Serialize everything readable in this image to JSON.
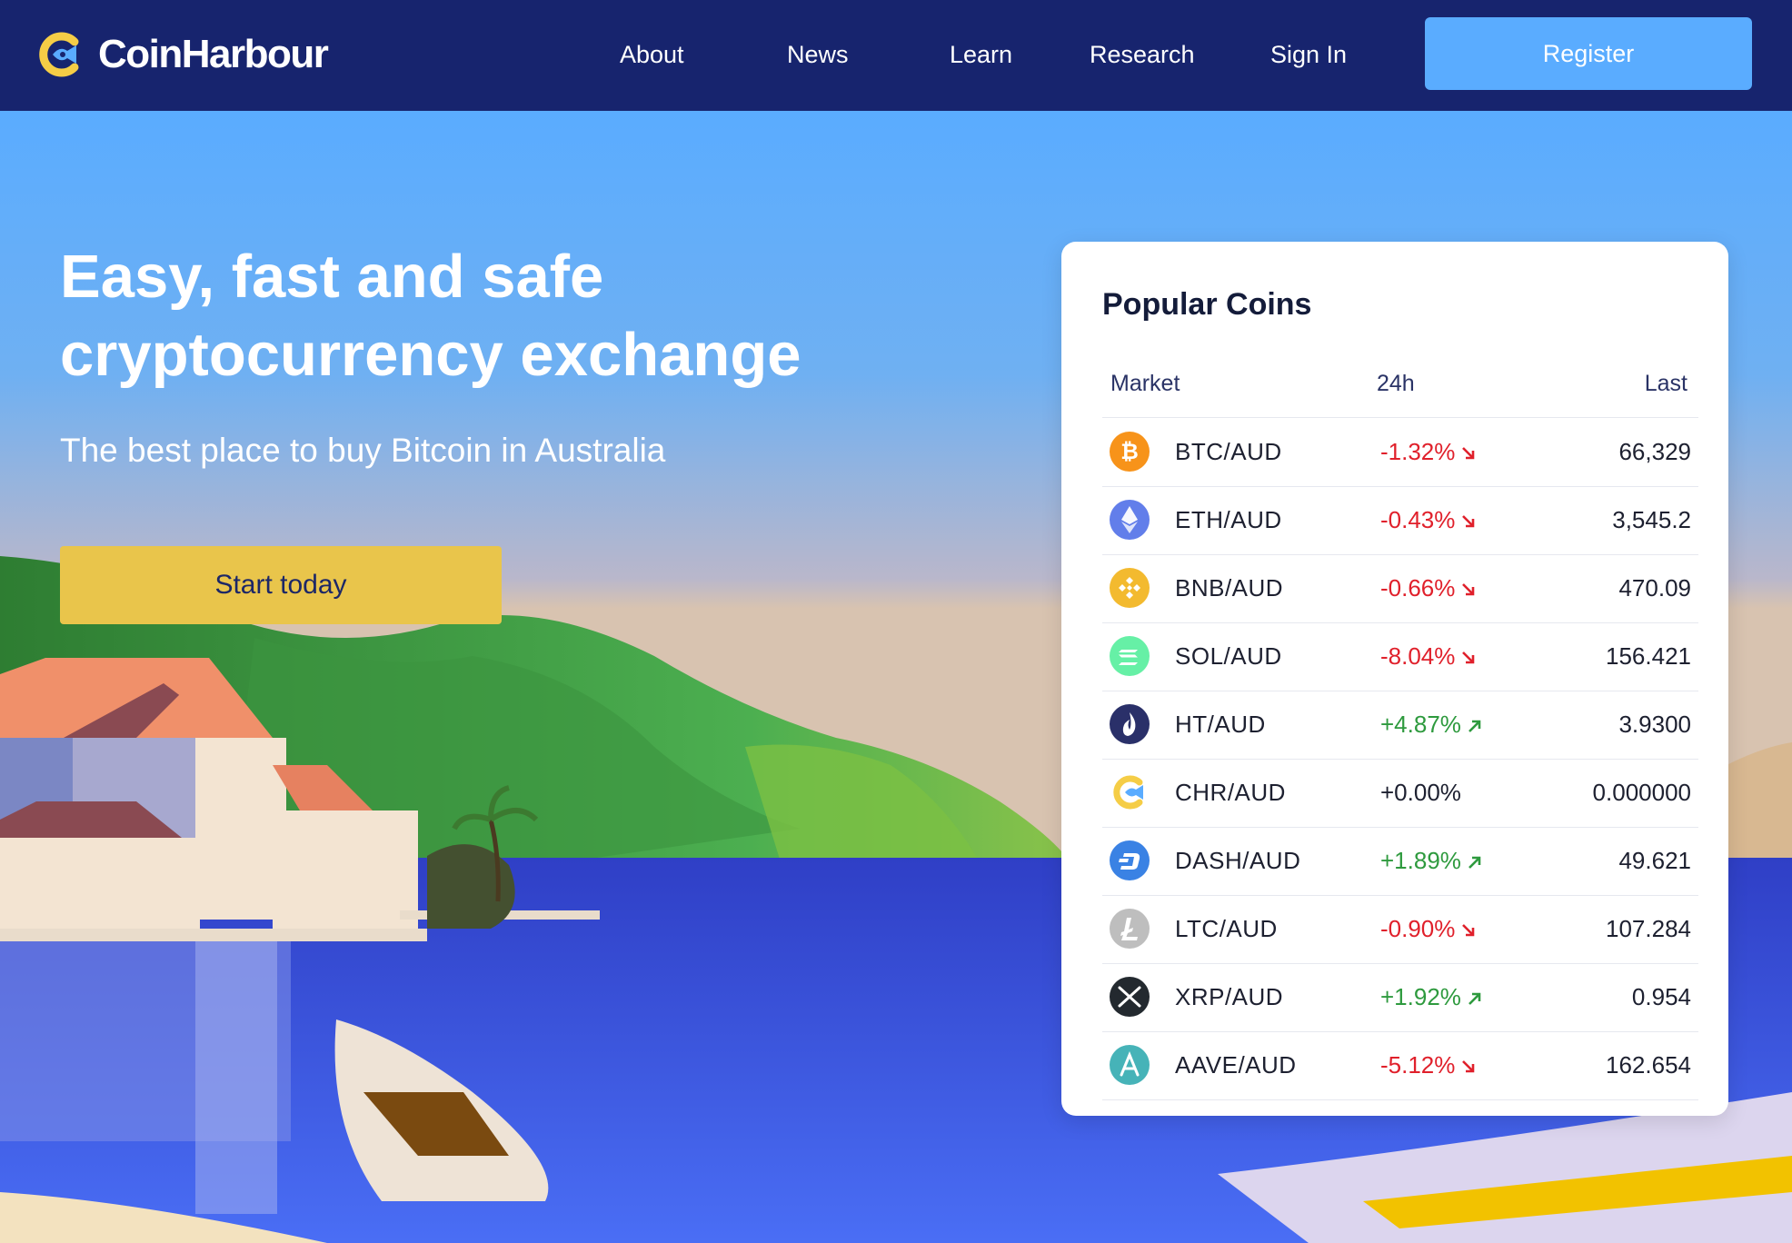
{
  "brand": {
    "name": "CoinHarbour",
    "accent": "#5aacff",
    "logo_yellow": "#f5cd46",
    "header_bg": "#17246e"
  },
  "nav": {
    "links": [
      {
        "label": "About"
      },
      {
        "label": "News"
      },
      {
        "label": "Learn"
      },
      {
        "label": "Research"
      },
      {
        "label": "Sign In"
      }
    ],
    "register_label": "Register"
  },
  "hero": {
    "title_line1": "Easy, fast and safe",
    "title_line2": "cryptocurrency exchange",
    "subtitle": "The best place to buy Bitcoin in Australia",
    "cta_label": "Start today",
    "cta_color": "#e9c54b"
  },
  "coins_panel": {
    "title": "Popular Coins",
    "columns": {
      "market": "Market",
      "change": "24h",
      "last": "Last"
    },
    "rows": [
      {
        "pair": "BTC/AUD",
        "change": "-1.32%",
        "direction": "down",
        "last": "66,329",
        "icon": "bitcoin-icon"
      },
      {
        "pair": "ETH/AUD",
        "change": "-0.43%",
        "direction": "down",
        "last": "3,545.2",
        "icon": "ethereum-icon"
      },
      {
        "pair": "BNB/AUD",
        "change": "-0.66%",
        "direction": "down",
        "last": "470.09",
        "icon": "bnb-icon"
      },
      {
        "pair": "SOL/AUD",
        "change": "-8.04%",
        "direction": "down",
        "last": "156.421",
        "icon": "solana-icon"
      },
      {
        "pair": "HT/AUD",
        "change": "+4.87%",
        "direction": "up",
        "last": "3.9300",
        "icon": "huobi-token-icon"
      },
      {
        "pair": "CHR/AUD",
        "change": "+0.00%",
        "direction": "flat",
        "last": "0.000000",
        "icon": "chr-icon"
      },
      {
        "pair": "DASH/AUD",
        "change": "+1.89%",
        "direction": "up",
        "last": "49.621",
        "icon": "dash-icon"
      },
      {
        "pair": "LTC/AUD",
        "change": "-0.90%",
        "direction": "down",
        "last": "107.284",
        "icon": "litecoin-icon"
      },
      {
        "pair": "XRP/AUD",
        "change": "+1.92%",
        "direction": "up",
        "last": "0.954",
        "icon": "xrp-icon"
      },
      {
        "pair": "AAVE/AUD",
        "change": "-5.12%",
        "direction": "down",
        "last": "162.654",
        "icon": "aave-icon"
      }
    ],
    "colors": {
      "negative": "#e0202b",
      "positive": "#2e9a3e"
    }
  }
}
